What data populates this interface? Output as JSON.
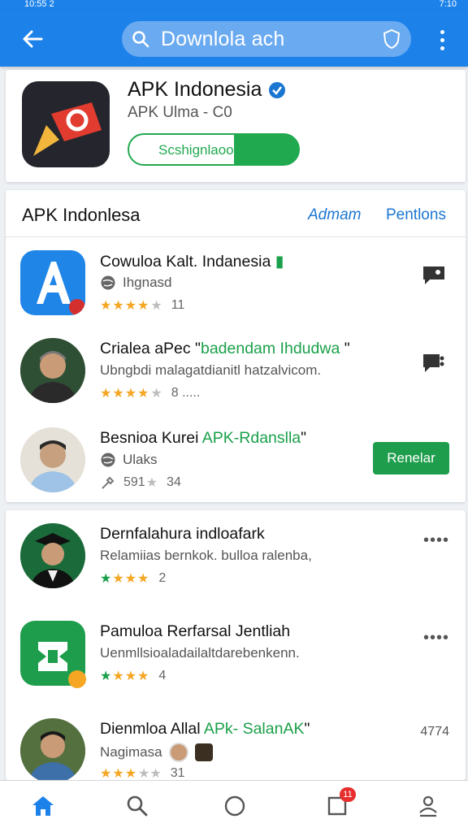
{
  "status_bar": {
    "left": "10:55 2",
    "right": "7:10"
  },
  "app_bar": {
    "search_text": "Downlola ach"
  },
  "top_card": {
    "title": "APK Indonesia",
    "subtitle": "APK Ulma - C0",
    "button_label": "Scshignlaoor"
  },
  "section": {
    "title": "APK Indonlesa",
    "link1": "Admam",
    "link2": "Pentlons"
  },
  "items": [
    {
      "name": "Cowuloa Kalt. Indanesia",
      "desc": "Ihgnasd",
      "rating": 4,
      "count": "11"
    },
    {
      "name_prefix": "Crialea aPec \"",
      "name_green": "badendam Ihdudwa",
      "name_suffix": " \"",
      "desc": "Ubngbdi malagatdianitl hatzalvicom.",
      "rating": 4,
      "count": "8 ....."
    },
    {
      "name_prefix": "Besnioa Kurei ",
      "name_green": "APK-Rdanslla",
      "name_suffix": "\"",
      "desc": "Ulaks",
      "rating_text": "591",
      "count": "34",
      "button": "Renelar"
    },
    {
      "name": "Dernfalahura indloafark",
      "desc": "Relamiias bernkok. bulloa ralenba,",
      "rating": 4,
      "count": "2"
    },
    {
      "name": "Pamuloa Rerfarsal Jentliah",
      "desc": "Uenmllsioaladailaltdarebenkenn.",
      "rating": 4,
      "count": "4"
    },
    {
      "name_prefix": "Dienmloa Allal ",
      "name_green": "APk- SalanAK",
      "name_suffix": "\"",
      "desc": "Nagimasa",
      "rating": 3,
      "count": "31",
      "right_num": "4774"
    }
  ],
  "bottom_nav": {
    "badge": "11"
  },
  "icons": [
    "back-arrow-icon",
    "search-icon",
    "shield-icon",
    "more-vert-icon",
    "home-icon",
    "circle-icon",
    "square-icon",
    "profile-icon",
    "globe-icon",
    "chat-icon",
    "wrench-icon",
    "star-icon"
  ],
  "colors": {
    "primary": "#1c82ea",
    "green": "#1e9e4c",
    "star": "#f5a623"
  }
}
